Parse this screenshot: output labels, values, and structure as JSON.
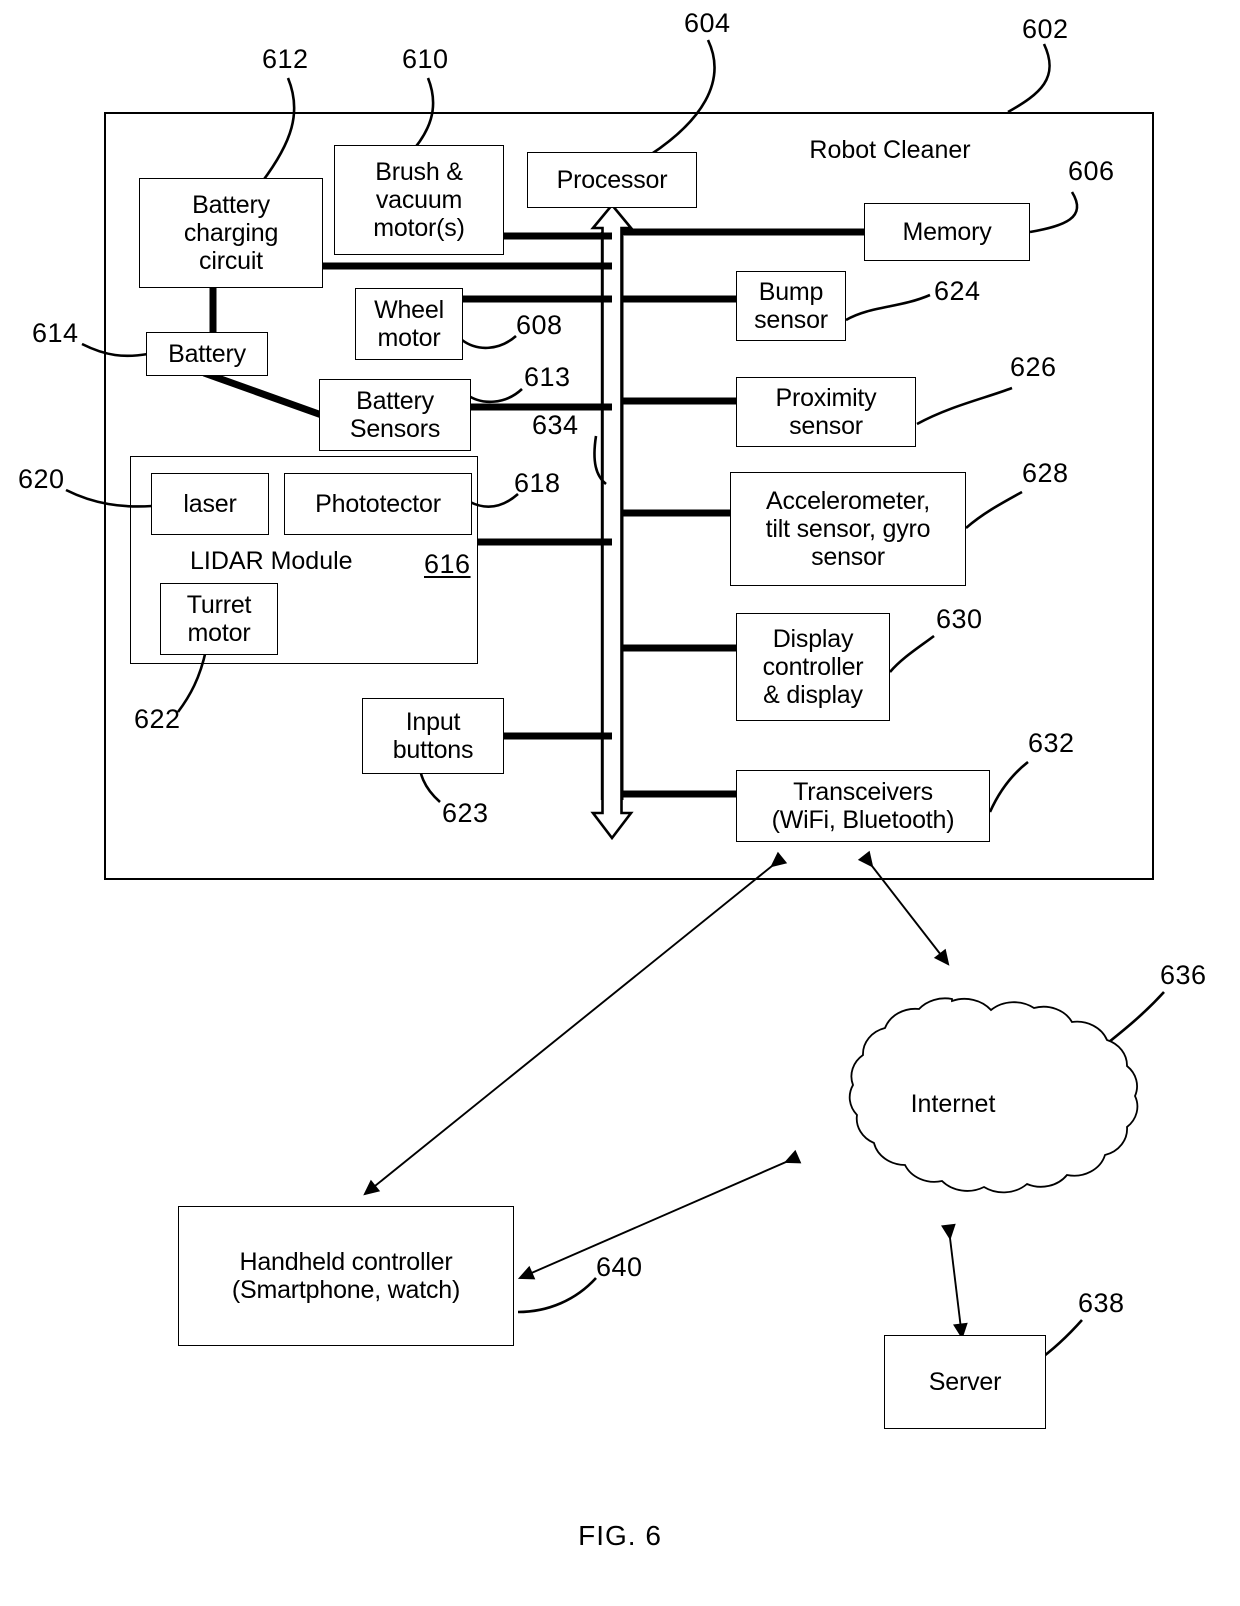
{
  "figure": {
    "caption": "FIG. 6",
    "title": "Robot Cleaner"
  },
  "reference_numerals": {
    "frame": "602",
    "processor": "604",
    "memory": "606",
    "wheel_motor": "608",
    "brush_vacuum_motor": "610",
    "battery_charging_circuit": "612",
    "battery_sensors": "613",
    "battery": "614",
    "lidar_module": "616",
    "phototector": "618",
    "laser": "620",
    "turret_motor": "622",
    "input_buttons": "623",
    "bump_sensor": "624",
    "proximity_sensor": "626",
    "accelerometer": "628",
    "display_controller": "630",
    "transceivers": "632",
    "bus": "634",
    "internet": "636",
    "server": "638",
    "handheld_controller": "640"
  },
  "blocks": {
    "battery_charging_circuit": "Battery\ncharging\ncircuit",
    "brush_vacuum_motor": "Brush &\nvacuum\nmotor(s)",
    "processor": "Processor",
    "memory": "Memory",
    "battery": "Battery",
    "wheel_motor": "Wheel\nmotor",
    "battery_sensors": "Battery\nSensors",
    "bump_sensor": "Bump\nsensor",
    "proximity_sensor": "Proximity\nsensor",
    "laser": "laser",
    "phototector": "Phototector",
    "lidar_module_label": "LIDAR Module",
    "turret_motor": "Turret\nmotor",
    "accelerometer": "Accelerometer,\ntilt sensor, gyro\nsensor",
    "display_controller": "Display\ncontroller\n& display",
    "input_buttons": "Input\nbuttons",
    "transceivers": "Transceivers\n(WiFi, Bluetooth)",
    "internet": "Internet",
    "server": "Server",
    "handheld_controller": "Handheld controller\n(Smartphone, watch)"
  },
  "colors": {
    "line": "#000000",
    "background": "#ffffff"
  }
}
